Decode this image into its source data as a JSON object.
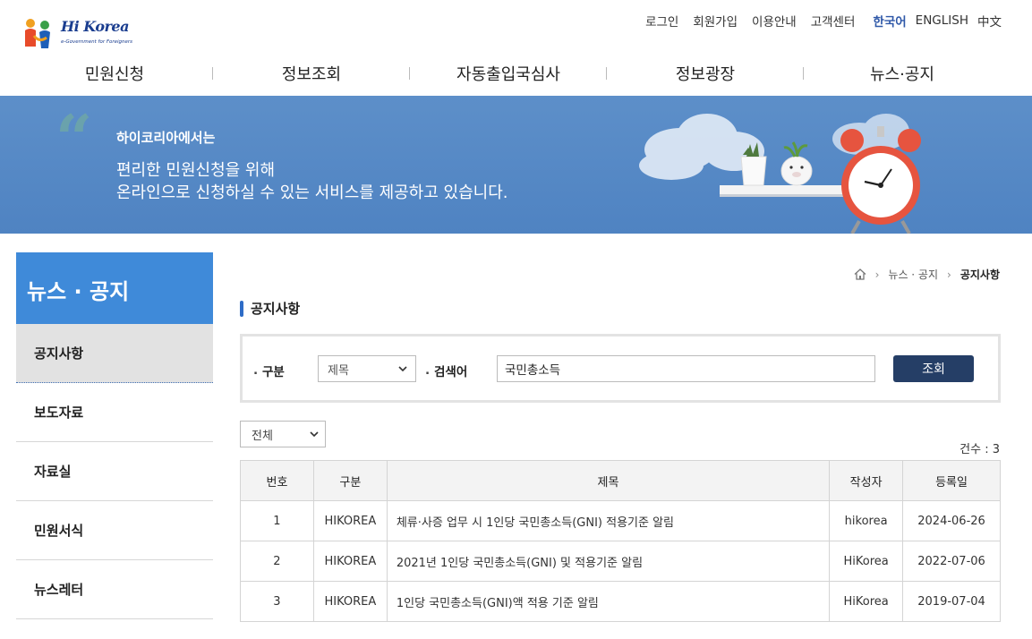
{
  "header": {
    "logo": {
      "main": "Hi Korea",
      "sub": "e-Government for Foreigners"
    },
    "util_links": [
      "로그인",
      "회원가입",
      "이용안내",
      "고객센터"
    ],
    "languages": [
      {
        "label": "한국어",
        "active": true
      },
      {
        "label": "ENGLISH",
        "active": false
      },
      {
        "label": "中文",
        "active": false
      }
    ],
    "nav": [
      "민원신청",
      "정보조회",
      "자동출입국심사",
      "정보광장",
      "뉴스·공지"
    ]
  },
  "banner": {
    "subtitle": "하이코리아에서는",
    "line1": "편리한 민원신청을 위해",
    "line2": "온라인으로 신청하실 수 있는 서비스를 제공하고 있습니다."
  },
  "sidebar": {
    "title": "뉴스 · 공지",
    "items": [
      {
        "label": "공지사항",
        "active": true
      },
      {
        "label": "보도자료",
        "active": false
      },
      {
        "label": "자료실",
        "active": false
      },
      {
        "label": "민원서식",
        "active": false
      },
      {
        "label": "뉴스레터",
        "active": false
      }
    ]
  },
  "breadcrumb": {
    "section": "뉴스 · 공지",
    "current": "공지사항"
  },
  "page_title": "공지사항",
  "search": {
    "category_label": "구분",
    "category_value": "제목",
    "keyword_label": "검색어",
    "keyword_value": "국민총소득",
    "button_label": "조회"
  },
  "filter": {
    "value": "전체"
  },
  "count_text": "건수 : 3",
  "table": {
    "headers": [
      "번호",
      "구분",
      "제목",
      "작성자",
      "등록일"
    ],
    "rows": [
      [
        "1",
        "HIKOREA",
        "체류·사증 업무 시 1인당 국민총소득(GNI) 적용기준 알림",
        "hikorea",
        "2024-06-26"
      ],
      [
        "2",
        "HIKOREA",
        "2021년 1인당 국민총소득(GNI) 및 적용기준 알림",
        "HiKorea",
        "2022-07-06"
      ],
      [
        "3",
        "HIKOREA",
        "1인당 국민총소득(GNI)액 적용 기준 알림",
        "HiKorea",
        "2019-07-04"
      ]
    ]
  },
  "colors": {
    "primary": "#3f8ad9",
    "banner": "#5588c4",
    "button": "#253e66"
  }
}
